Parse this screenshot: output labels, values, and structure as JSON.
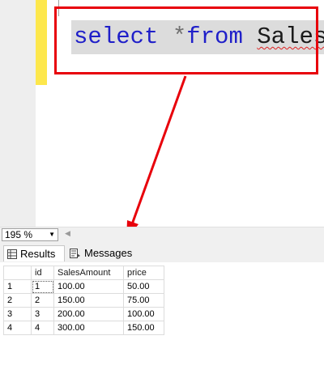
{
  "editor": {
    "keyword_select": "select",
    "operator": "*",
    "keyword_from": "from",
    "table_name": "Sales",
    "highlight_color": "#e8000b"
  },
  "status": {
    "zoom_level": "195 %"
  },
  "tabs": {
    "results": "Results",
    "messages": "Messages"
  },
  "grid": {
    "columns": [
      "id",
      "SalesAmount",
      "price"
    ],
    "rows": [
      {
        "num": "1",
        "id": "1",
        "amount": "100.00",
        "price": "50.00"
      },
      {
        "num": "2",
        "id": "2",
        "amount": "150.00",
        "price": "75.00"
      },
      {
        "num": "3",
        "id": "3",
        "amount": "200.00",
        "price": "100.00"
      },
      {
        "num": "4",
        "id": "4",
        "amount": "300.00",
        "price": "150.00"
      }
    ]
  }
}
